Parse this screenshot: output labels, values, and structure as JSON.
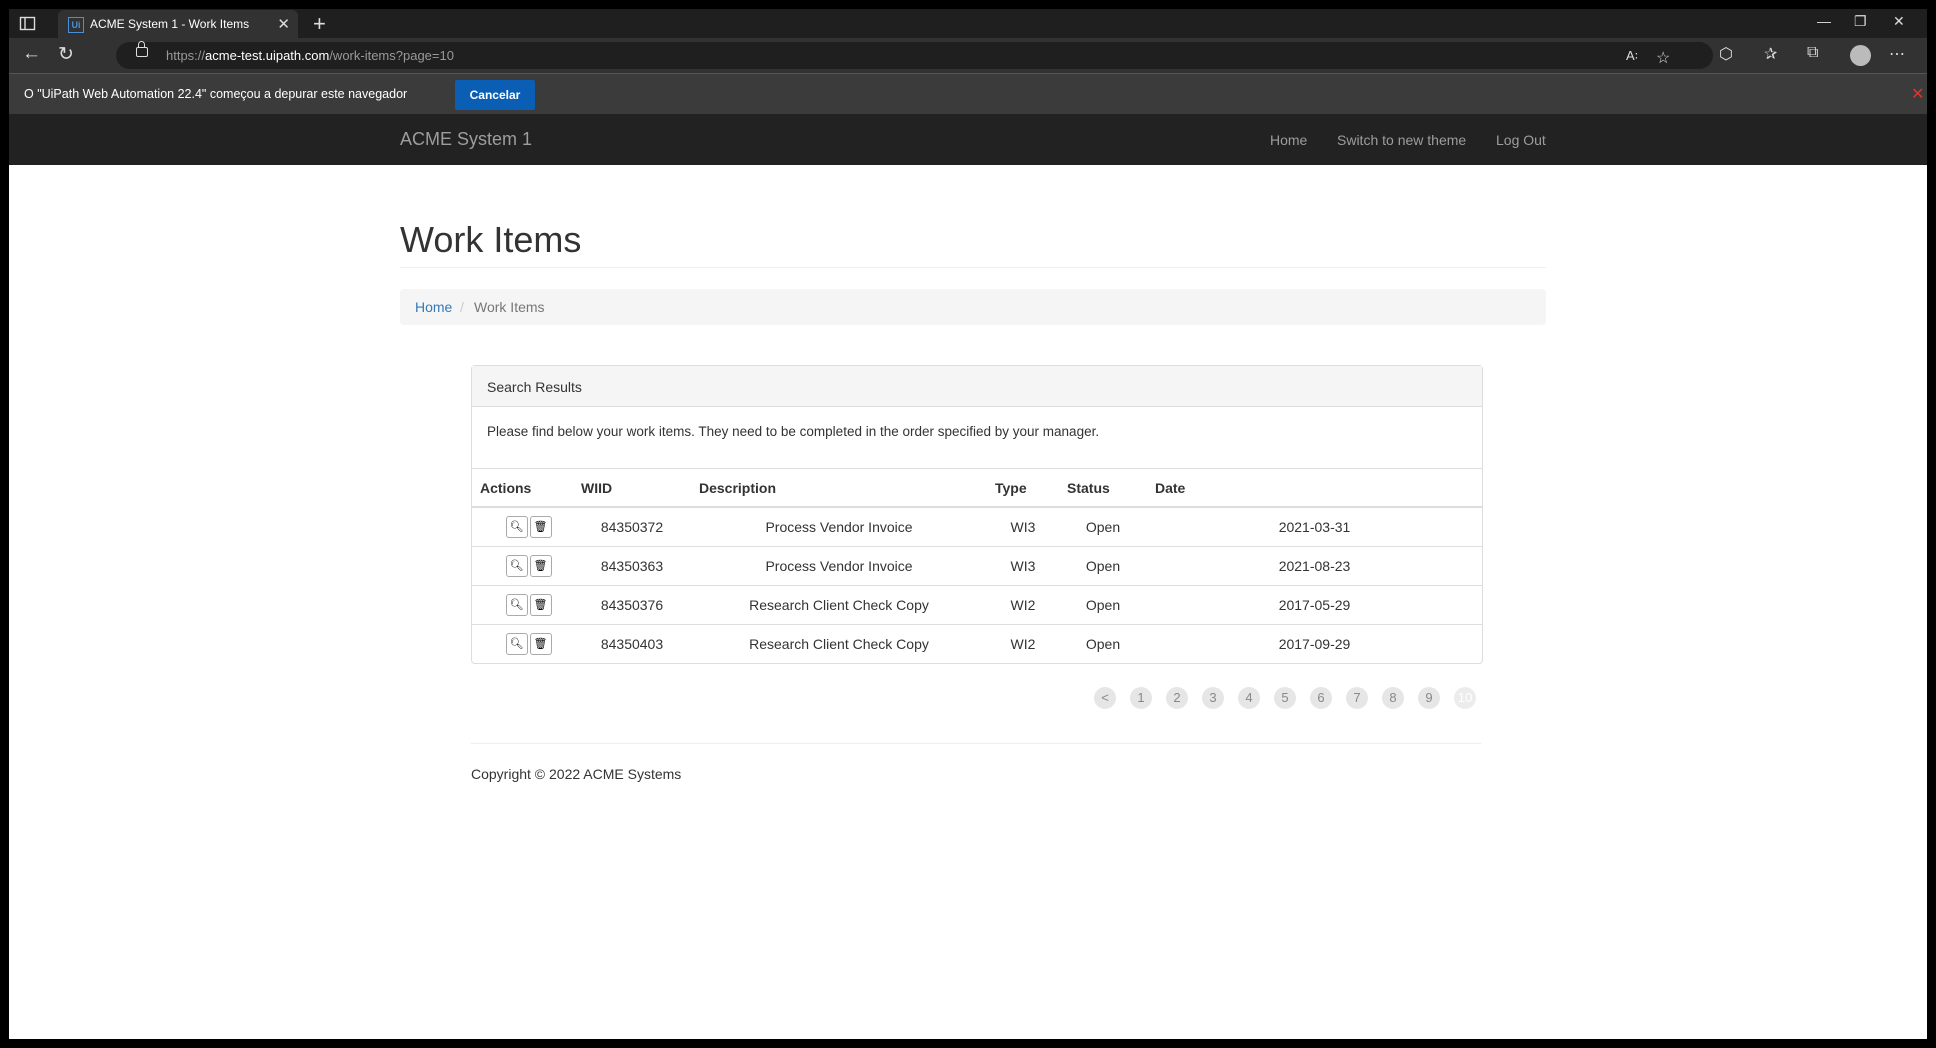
{
  "browser": {
    "tab_title": "ACME System 1 - Work Items",
    "url_prefix": "https://",
    "url_host": "acme-test.uipath.com",
    "url_path": "/work-items?page=10"
  },
  "infobar": {
    "message": "O \"UiPath Web Automation 22.4\" começou a depurar este navegador",
    "cancel_label": "Cancelar"
  },
  "navbar": {
    "brand": "ACME System 1",
    "links": [
      "Home",
      "Switch to new theme",
      "Log Out"
    ]
  },
  "page": {
    "title": "Work Items",
    "breadcrumb_home": "Home",
    "breadcrumb_sep": "/",
    "breadcrumb_current": "Work Items"
  },
  "panel": {
    "heading": "Search Results",
    "description": "Please find below your work items. They need to be completed in the order specified by your manager.",
    "columns": [
      "Actions",
      "WIID",
      "Description",
      "Type",
      "Status",
      "Date"
    ],
    "rows": [
      {
        "wiid": "84350372",
        "description": "Process Vendor Invoice",
        "type": "WI3",
        "status": "Open",
        "date": "2021-03-31"
      },
      {
        "wiid": "84350363",
        "description": "Process Vendor Invoice",
        "type": "WI3",
        "status": "Open",
        "date": "2021-08-23"
      },
      {
        "wiid": "84350376",
        "description": "Research Client Check Copy",
        "type": "WI2",
        "status": "Open",
        "date": "2017-05-29"
      },
      {
        "wiid": "84350403",
        "description": "Research Client Check Copy",
        "type": "WI2",
        "status": "Open",
        "date": "2017-09-29"
      }
    ]
  },
  "pagination": {
    "prev_label": "<",
    "pages": [
      "1",
      "2",
      "3",
      "4",
      "5",
      "6",
      "7",
      "8",
      "9",
      "10"
    ],
    "current": "10"
  },
  "footer": {
    "copyright": "Copyright © 2022 ACME Systems"
  }
}
